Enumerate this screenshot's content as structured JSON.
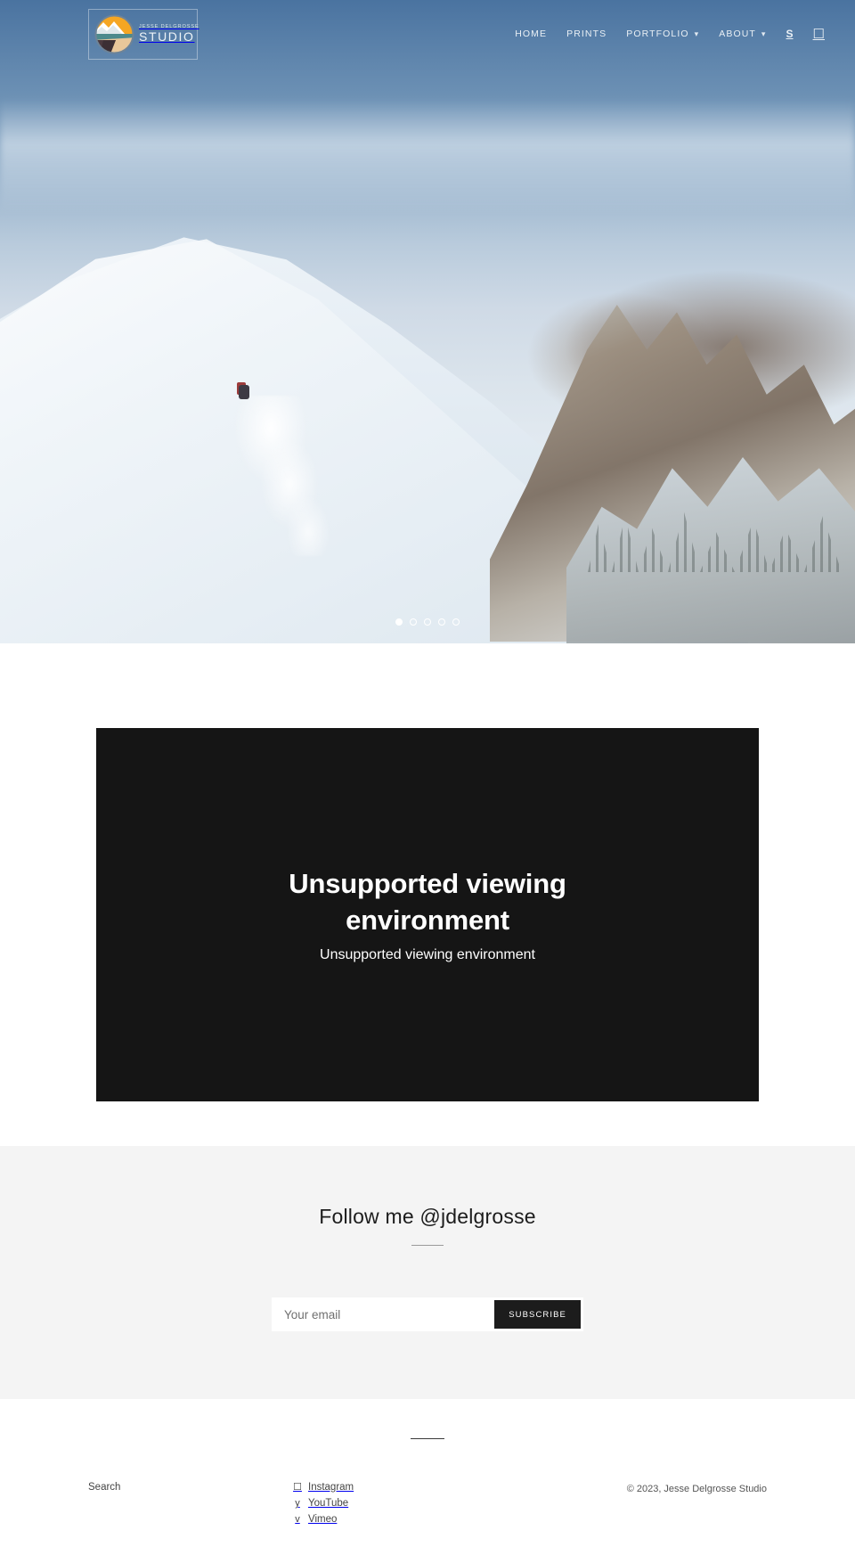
{
  "brand": {
    "logo_top": "JESSE DELGROSSE",
    "logo_bottom": "STUDIO",
    "logo_icon": "mountain-sunset-circle-logo"
  },
  "nav": {
    "items": [
      {
        "label": "HOME",
        "caret": ""
      },
      {
        "label": "PRINTS",
        "caret": ""
      },
      {
        "label": "PORTFOLIO",
        "caret": "▾"
      },
      {
        "label": "ABOUT",
        "caret": "▾"
      }
    ],
    "search_glyph": "S",
    "cart_glyph": "☐"
  },
  "hero": {
    "alt": "skier descending snowy mountain slope with powder spray",
    "dots": [
      {
        "active": true
      },
      {
        "active": false
      },
      {
        "active": false
      },
      {
        "active": false
      },
      {
        "active": false
      }
    ]
  },
  "video": {
    "title": "Unsupported viewing environment",
    "subtitle": "Unsupported viewing environment"
  },
  "newsletter": {
    "title": "Follow me @jdelgrosse",
    "email_placeholder": "Your email",
    "email_value": "",
    "subscribe_label": "SUBSCRIBE"
  },
  "footer": {
    "search_label": "Search",
    "social": [
      {
        "glyph": "☐",
        "name": "Instagram",
        "icon": "instagram-icon"
      },
      {
        "glyph": "y",
        "name": "YouTube",
        "icon": "youtube-icon"
      },
      {
        "glyph": "v",
        "name": "Vimeo",
        "icon": "vimeo-icon"
      }
    ],
    "copyright": "© 2023, Jesse Delgrosse Studio"
  },
  "colors": {
    "dark": "#1c1c1c",
    "newsletter_bg": "#f4f4f4",
    "video_bg": "#151515"
  }
}
